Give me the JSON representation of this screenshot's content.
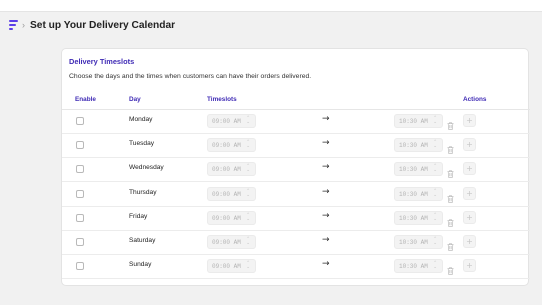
{
  "header": {
    "title": "Set up Your Delivery Calendar",
    "breadcrumb_separator": "›",
    "app_icon": "app-logo-icon"
  },
  "card": {
    "title": "Delivery Timeslots",
    "description": "Choose the days and the times when customers can have their orders delivered."
  },
  "table": {
    "columns": {
      "enable": "Enable",
      "day": "Day",
      "timeslots": "Timeslots",
      "actions": "Actions"
    },
    "arrow": "→",
    "rows": [
      {
        "day": "Monday",
        "enabled": false,
        "start": "09:00 AM",
        "end": "10:30 AM"
      },
      {
        "day": "Tuesday",
        "enabled": false,
        "start": "09:00 AM",
        "end": "10:30 AM"
      },
      {
        "day": "Wednesday",
        "enabled": false,
        "start": "09:00 AM",
        "end": "10:30 AM"
      },
      {
        "day": "Thursday",
        "enabled": false,
        "start": "09:00 AM",
        "end": "10:30 AM"
      },
      {
        "day": "Friday",
        "enabled": false,
        "start": "09:00 AM",
        "end": "10:30 AM"
      },
      {
        "day": "Saturday",
        "enabled": false,
        "start": "09:00 AM",
        "end": "10:30 AM"
      },
      {
        "day": "Sunday",
        "enabled": false,
        "start": "09:00 AM",
        "end": "10:30 AM"
      }
    ],
    "add_label": "+",
    "spinner_glyph": "⌃⌄"
  },
  "colors": {
    "accent": "#3f2bb5",
    "brand": "#5b3ee8",
    "background": "#f1f1f1"
  }
}
